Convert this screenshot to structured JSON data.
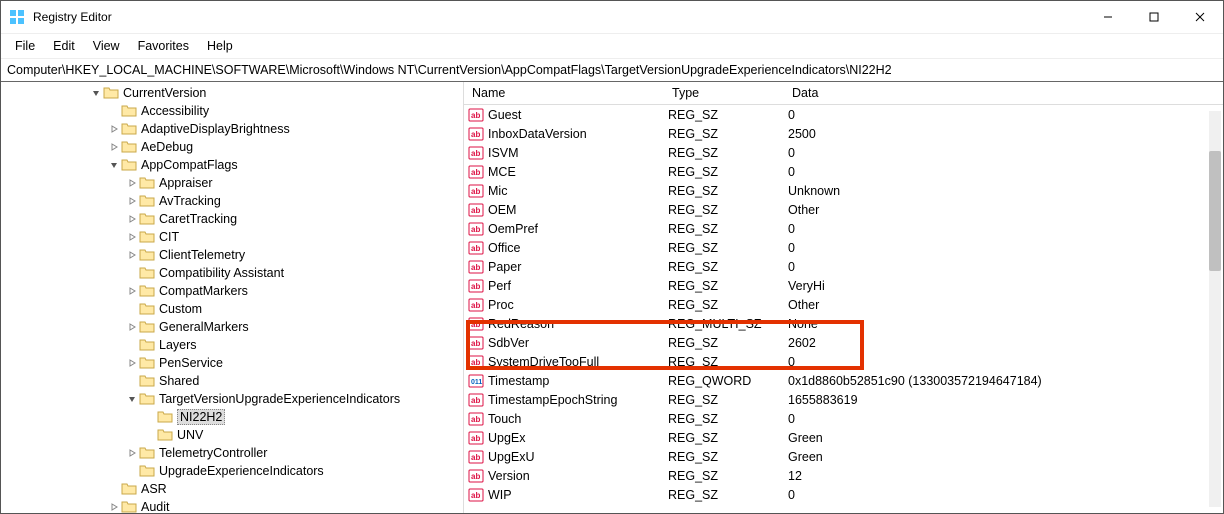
{
  "window": {
    "title": "Registry Editor"
  },
  "menu": {
    "items": [
      "File",
      "Edit",
      "View",
      "Favorites",
      "Help"
    ]
  },
  "address": "Computer\\HKEY_LOCAL_MACHINE\\SOFTWARE\\Microsoft\\Windows NT\\CurrentVersion\\AppCompatFlags\\TargetVersionUpgradeExperienceIndicators\\NI22H2",
  "columns": {
    "name": "Name",
    "type": "Type",
    "data": "Data"
  },
  "highlighted_value_index": 12,
  "tree": [
    {
      "indent": 0,
      "exp": "down",
      "label": "CurrentVersion",
      "name": "tree-currentversion"
    },
    {
      "indent": 1,
      "exp": "none",
      "label": "Accessibility",
      "name": "tree-accessibility"
    },
    {
      "indent": 1,
      "exp": "right",
      "label": "AdaptiveDisplayBrightness",
      "name": "tree-adaptivedisplaybrightness"
    },
    {
      "indent": 1,
      "exp": "right",
      "label": "AeDebug",
      "name": "tree-aedebug"
    },
    {
      "indent": 1,
      "exp": "down",
      "label": "AppCompatFlags",
      "name": "tree-appcompatflags"
    },
    {
      "indent": 2,
      "exp": "right",
      "label": "Appraiser",
      "name": "tree-appraiser"
    },
    {
      "indent": 2,
      "exp": "right",
      "label": "AvTracking",
      "name": "tree-avtracking"
    },
    {
      "indent": 2,
      "exp": "right",
      "label": "CaretTracking",
      "name": "tree-carettracking"
    },
    {
      "indent": 2,
      "exp": "right",
      "label": "CIT",
      "name": "tree-cit"
    },
    {
      "indent": 2,
      "exp": "right",
      "label": "ClientTelemetry",
      "name": "tree-clienttelemetry"
    },
    {
      "indent": 2,
      "exp": "none",
      "label": "Compatibility Assistant",
      "name": "tree-compatibility-assistant"
    },
    {
      "indent": 2,
      "exp": "right",
      "label": "CompatMarkers",
      "name": "tree-compatmarkers"
    },
    {
      "indent": 2,
      "exp": "none",
      "label": "Custom",
      "name": "tree-custom"
    },
    {
      "indent": 2,
      "exp": "right",
      "label": "GeneralMarkers",
      "name": "tree-generalmarkers"
    },
    {
      "indent": 2,
      "exp": "none",
      "label": "Layers",
      "name": "tree-layers"
    },
    {
      "indent": 2,
      "exp": "right",
      "label": "PenService",
      "name": "tree-penservice"
    },
    {
      "indent": 2,
      "exp": "none",
      "label": "Shared",
      "name": "tree-shared"
    },
    {
      "indent": 2,
      "exp": "down",
      "label": "TargetVersionUpgradeExperienceIndicators",
      "name": "tree-tvuei"
    },
    {
      "indent": 3,
      "exp": "none",
      "label": "NI22H2",
      "name": "tree-ni22h2",
      "selected": true
    },
    {
      "indent": 3,
      "exp": "none",
      "label": "UNV",
      "name": "tree-unv"
    },
    {
      "indent": 2,
      "exp": "right",
      "label": "TelemetryController",
      "name": "tree-telemetrycontroller"
    },
    {
      "indent": 2,
      "exp": "none",
      "label": "UpgradeExperienceIndicators",
      "name": "tree-upgradeexperienceindicators"
    },
    {
      "indent": 1,
      "exp": "none",
      "label": "ASR",
      "name": "tree-asr"
    },
    {
      "indent": 1,
      "exp": "right",
      "label": "Audit",
      "name": "tree-audit"
    }
  ],
  "values": [
    {
      "name": "Guest",
      "type": "REG_SZ",
      "data": "0",
      "icon": "str"
    },
    {
      "name": "InboxDataVersion",
      "type": "REG_SZ",
      "data": "2500",
      "icon": "str"
    },
    {
      "name": "ISVM",
      "type": "REG_SZ",
      "data": "0",
      "icon": "str"
    },
    {
      "name": "MCE",
      "type": "REG_SZ",
      "data": "0",
      "icon": "str"
    },
    {
      "name": "Mic",
      "type": "REG_SZ",
      "data": "Unknown",
      "icon": "str"
    },
    {
      "name": "OEM",
      "type": "REG_SZ",
      "data": "Other",
      "icon": "str"
    },
    {
      "name": "OemPref",
      "type": "REG_SZ",
      "data": "0",
      "icon": "str"
    },
    {
      "name": "Office",
      "type": "REG_SZ",
      "data": "0",
      "icon": "str"
    },
    {
      "name": "Paper",
      "type": "REG_SZ",
      "data": "0",
      "icon": "str"
    },
    {
      "name": "Perf",
      "type": "REG_SZ",
      "data": "VeryHi",
      "icon": "str"
    },
    {
      "name": "Proc",
      "type": "REG_SZ",
      "data": "Other",
      "icon": "str"
    },
    {
      "name": "RedReason",
      "type": "REG_MULTI_SZ",
      "data": "None",
      "icon": "str"
    },
    {
      "name": "SdbVer",
      "type": "REG_SZ",
      "data": "2602",
      "icon": "str"
    },
    {
      "name": "SystemDriveTooFull",
      "type": "REG_SZ",
      "data": "0",
      "icon": "str"
    },
    {
      "name": "Timestamp",
      "type": "REG_QWORD",
      "data": "0x1d8860b52851c90 (133003572194647184)",
      "icon": "bin"
    },
    {
      "name": "TimestampEpochString",
      "type": "REG_SZ",
      "data": "1655883619",
      "icon": "str"
    },
    {
      "name": "Touch",
      "type": "REG_SZ",
      "data": "0",
      "icon": "str"
    },
    {
      "name": "UpgEx",
      "type": "REG_SZ",
      "data": "Green",
      "icon": "str"
    },
    {
      "name": "UpgExU",
      "type": "REG_SZ",
      "data": "Green",
      "icon": "str"
    },
    {
      "name": "Version",
      "type": "REG_SZ",
      "data": "12",
      "icon": "str"
    },
    {
      "name": "WIP",
      "type": "REG_SZ",
      "data": "0",
      "icon": "str"
    }
  ]
}
